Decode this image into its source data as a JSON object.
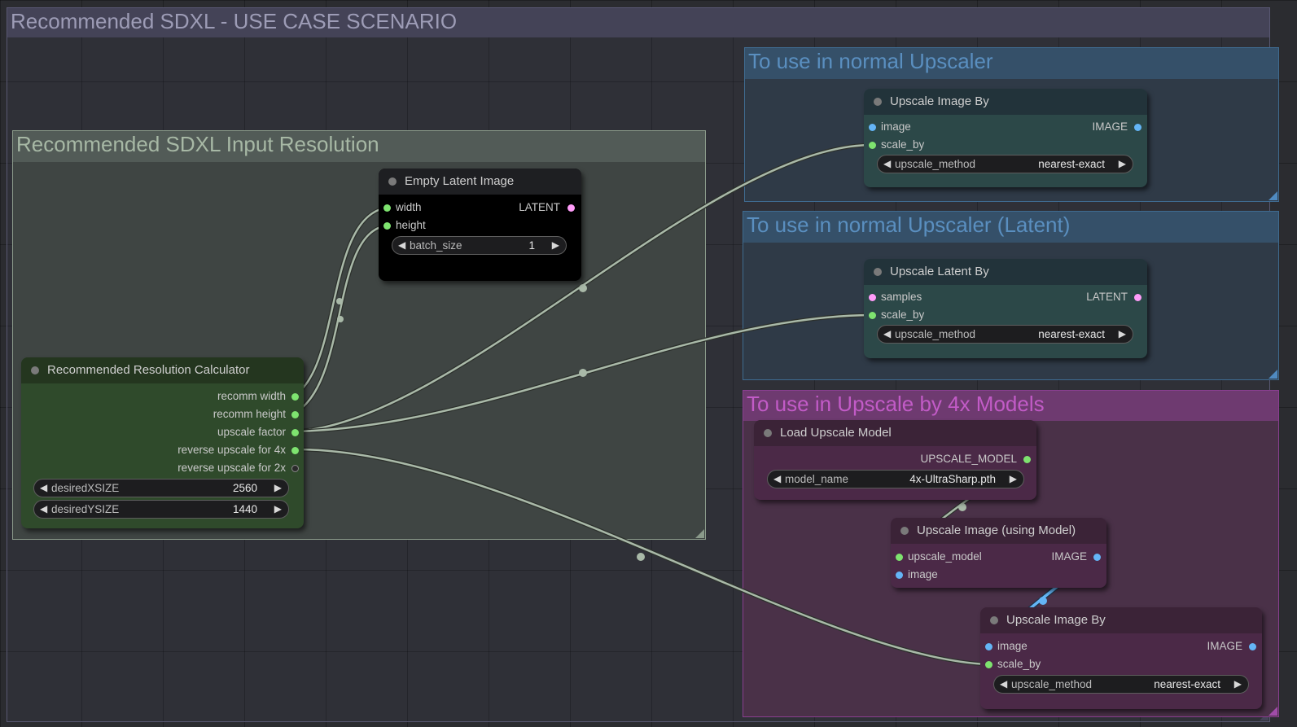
{
  "colors": {
    "canvas": "#2b2c30",
    "slot_int": "#7ee36f",
    "slot_image": "#64b5f6",
    "slot_latent": "#ff9cf9",
    "link": "#a9b9a8",
    "link_image": "#64b5f6"
  },
  "groups": {
    "main": {
      "title": "Recommended SDXL - USE CASE SCENARIO"
    },
    "input_res": {
      "title": "Recommended SDXL Input Resolution"
    },
    "normal_upscaler": {
      "title": "To use in normal Upscaler"
    },
    "latent_upscaler": {
      "title": "To use in normal Upscaler (Latent)"
    },
    "model_upscaler": {
      "title": "To use in Upscale by 4x Models"
    }
  },
  "nodes": {
    "empty_latent": {
      "title": "Empty Latent Image",
      "inputs": [
        "width",
        "height"
      ],
      "output": "LATENT",
      "widget": {
        "name": "batch_size",
        "value": "1"
      }
    },
    "res_calc": {
      "title": "Recommended Resolution Calculator",
      "outputs": [
        "recomm width",
        "recomm height",
        "upscale factor",
        "reverse upscale for 4x",
        "reverse upscale for 2x"
      ],
      "widgets": [
        {
          "name": "desiredXSIZE",
          "value": "2560"
        },
        {
          "name": "desiredYSIZE",
          "value": "1440"
        }
      ]
    },
    "upscale_image_by_1": {
      "title": "Upscale Image By",
      "inputs": [
        "image",
        "scale_by"
      ],
      "output": "IMAGE",
      "widget": {
        "name": "upscale_method",
        "value": "nearest-exact"
      }
    },
    "upscale_latent_by": {
      "title": "Upscale Latent By",
      "inputs": [
        "samples",
        "scale_by"
      ],
      "output": "LATENT",
      "widget": {
        "name": "upscale_method",
        "value": "nearest-exact"
      }
    },
    "load_upscale_model": {
      "title": "Load Upscale Model",
      "output": "UPSCALE_MODEL",
      "widget": {
        "name": "model_name",
        "value": "4x-UltraSharp.pth"
      }
    },
    "upscale_with_model": {
      "title": "Upscale Image (using Model)",
      "inputs": [
        "upscale_model",
        "image"
      ],
      "output": "IMAGE"
    },
    "upscale_image_by_2": {
      "title": "Upscale Image By",
      "inputs": [
        "image",
        "scale_by"
      ],
      "output": "IMAGE",
      "widget": {
        "name": "upscale_method",
        "value": "nearest-exact"
      }
    }
  }
}
